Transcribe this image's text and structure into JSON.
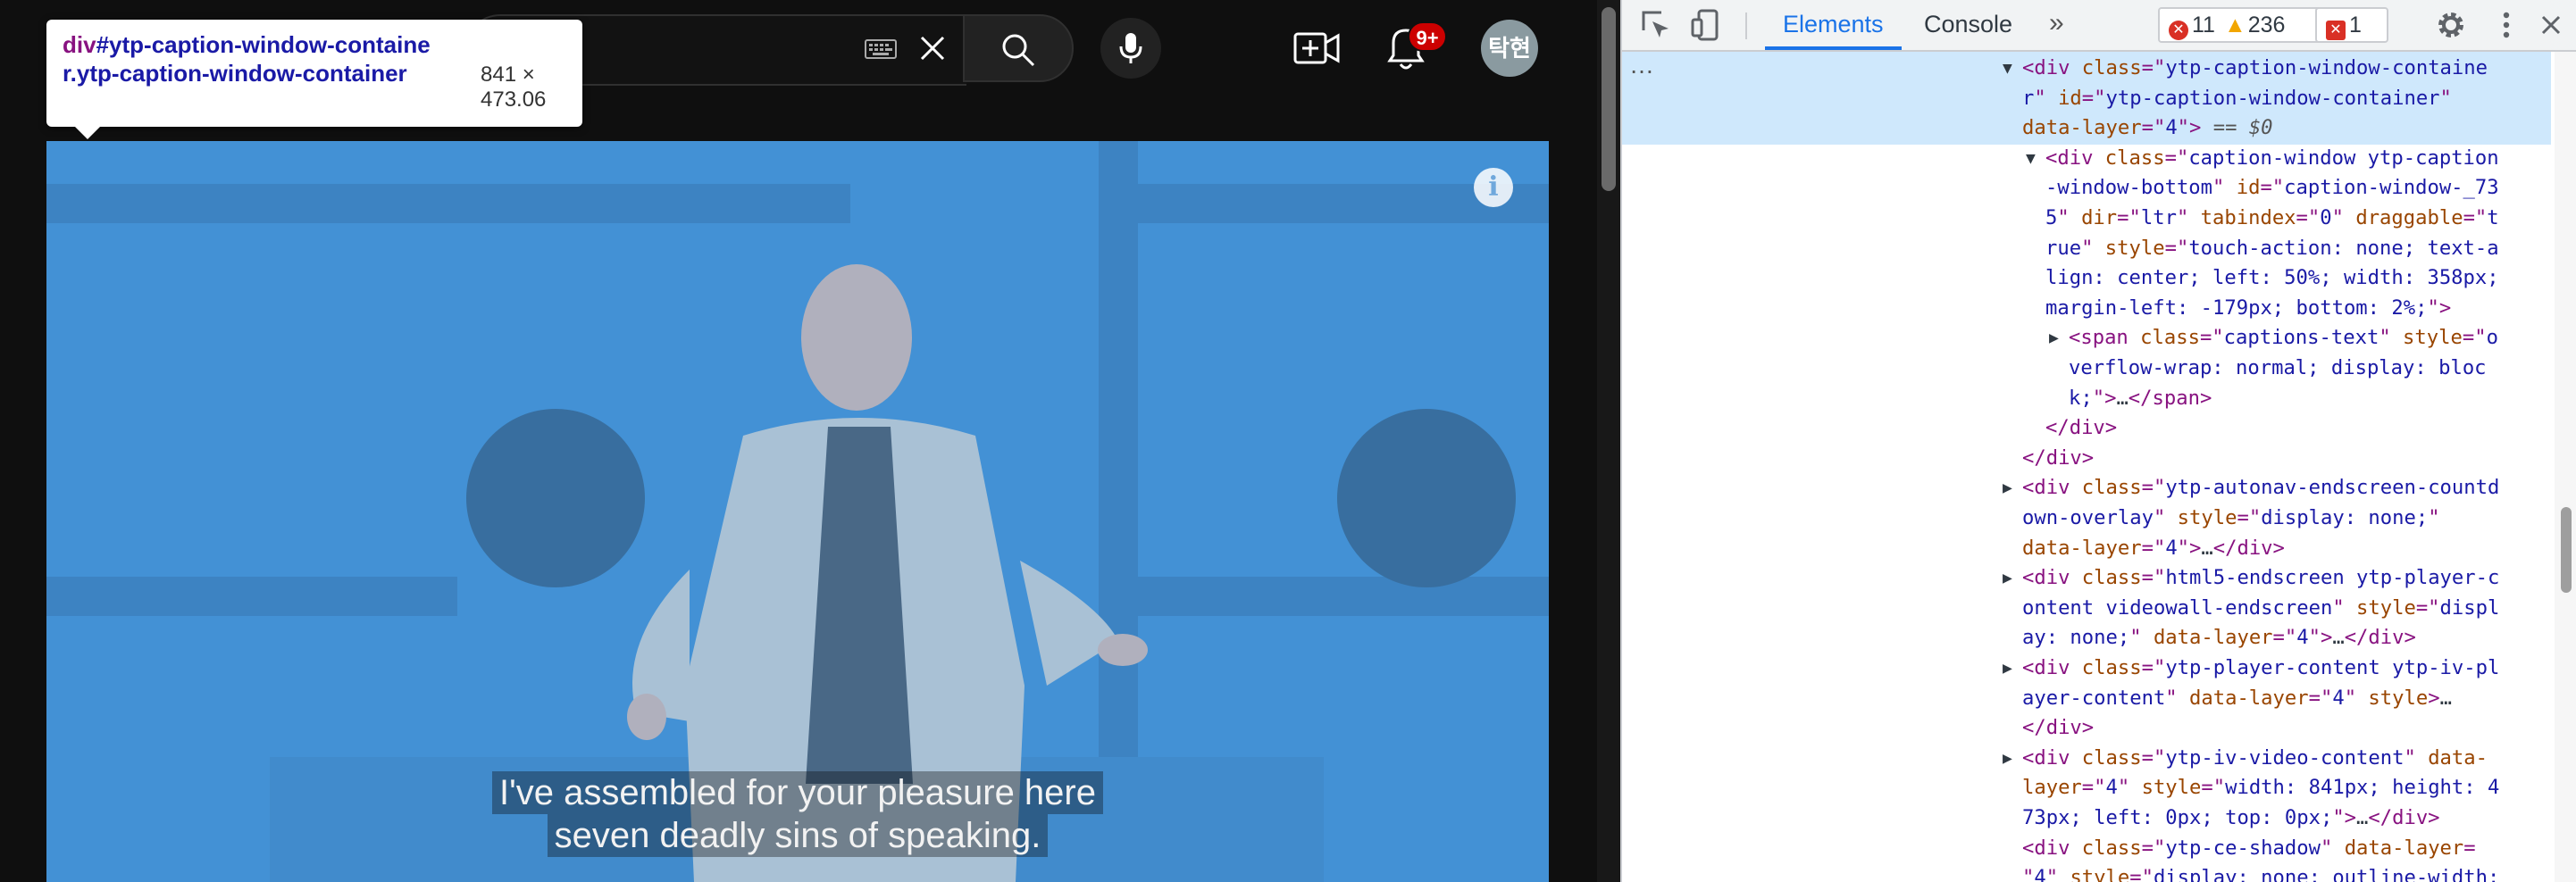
{
  "youtube": {
    "notification_count": "9+",
    "avatar_text": "탁현",
    "icons": {
      "keyboard": "keyboard-icon",
      "clear": "close-icon",
      "search": "search-icon",
      "mic": "microphone-icon",
      "create": "video-plus-icon",
      "bell": "bell-icon",
      "info": "info-icon"
    }
  },
  "inspect_tooltip": {
    "tag": "div",
    "selector": "#ytp-caption-window-container.ytp-caption-window-container",
    "dimensions": "841 × 473.06"
  },
  "video": {
    "info_glyph": "i",
    "captions": [
      "I've assembled for your pleasure here",
      "seven deadly sins of speaking."
    ]
  },
  "devtools": {
    "tabs": [
      "Elements",
      "Console"
    ],
    "active_tab": "Elements",
    "more_tabs": "»",
    "errors": "11",
    "warnings": "236",
    "issues": "1",
    "ellipsis": "…",
    "colors": {
      "accent": "#1a73e8",
      "selection": "#cfe8fc",
      "tag": "#881280",
      "attr_name": "#994500",
      "attr_value": "#1a1aa6"
    }
  },
  "dom_lines": [
    {
      "indent": 0,
      "arrow": "▼",
      "parts": [
        [
          "tag",
          "<div "
        ],
        [
          "an",
          "class"
        ],
        [
          "tag",
          "=\""
        ],
        [
          "av",
          "ytp-caption-window-containe"
        ]
      ]
    },
    {
      "indent": 0,
      "arrow": "",
      "parts": [
        [
          "av",
          "r"
        ],
        [
          "tag",
          "\" "
        ],
        [
          "an",
          "id"
        ],
        [
          "tag",
          "=\""
        ],
        [
          "av",
          "ytp-caption-window-container"
        ],
        [
          "tag",
          "\""
        ]
      ]
    },
    {
      "indent": 0,
      "arrow": "",
      "parts": [
        [
          "an",
          "data-layer"
        ],
        [
          "tag",
          "=\""
        ],
        [
          "av",
          "4"
        ],
        [
          "tag",
          "\">"
        ],
        [
          "eq",
          " == $0"
        ]
      ]
    },
    {
      "indent": 1,
      "arrow": "▼",
      "parts": [
        [
          "tag",
          "<div "
        ],
        [
          "an",
          "class"
        ],
        [
          "tag",
          "=\""
        ],
        [
          "av",
          "caption-window ytp-caption"
        ]
      ]
    },
    {
      "indent": 1,
      "arrow": "",
      "parts": [
        [
          "av",
          "-window-bottom"
        ],
        [
          "tag",
          "\" "
        ],
        [
          "an",
          "id"
        ],
        [
          "tag",
          "=\""
        ],
        [
          "av",
          "caption-window-_73"
        ]
      ]
    },
    {
      "indent": 1,
      "arrow": "",
      "parts": [
        [
          "av",
          "5"
        ],
        [
          "tag",
          "\" "
        ],
        [
          "an",
          "dir"
        ],
        [
          "tag",
          "=\""
        ],
        [
          "av",
          "ltr"
        ],
        [
          "tag",
          "\" "
        ],
        [
          "an",
          "tabindex"
        ],
        [
          "tag",
          "=\""
        ],
        [
          "av",
          "0"
        ],
        [
          "tag",
          "\" "
        ],
        [
          "an",
          "draggable"
        ],
        [
          "tag",
          "=\""
        ],
        [
          "av",
          "t"
        ]
      ]
    },
    {
      "indent": 1,
      "arrow": "",
      "parts": [
        [
          "av",
          "rue"
        ],
        [
          "tag",
          "\" "
        ],
        [
          "an",
          "style"
        ],
        [
          "tag",
          "=\""
        ],
        [
          "av",
          "touch-action: none; text-a"
        ]
      ]
    },
    {
      "indent": 1,
      "arrow": "",
      "parts": [
        [
          "av",
          "lign: center; left: 50%; width: 358px;"
        ]
      ]
    },
    {
      "indent": 1,
      "arrow": "",
      "parts": [
        [
          "av",
          "margin-left: -179px; bottom: 2%;"
        ],
        [
          "tag",
          "\">"
        ]
      ]
    },
    {
      "indent": 2,
      "arrow": "▶",
      "parts": [
        [
          "tag",
          "<span "
        ],
        [
          "an",
          "class"
        ],
        [
          "tag",
          "=\""
        ],
        [
          "av",
          "captions-text"
        ],
        [
          "tag",
          "\" "
        ],
        [
          "an",
          "style"
        ],
        [
          "tag",
          "=\""
        ],
        [
          "av",
          "o"
        ]
      ]
    },
    {
      "indent": 2,
      "arrow": "",
      "parts": [
        [
          "av",
          "verflow-wrap: normal; display: bloc"
        ]
      ]
    },
    {
      "indent": 2,
      "arrow": "",
      "parts": [
        [
          "av",
          "k;"
        ],
        [
          "tag",
          "\">"
        ],
        [
          "tx",
          "…"
        ],
        [
          "tag",
          "</span>"
        ]
      ]
    },
    {
      "indent": 1,
      "arrow": "",
      "parts": [
        [
          "tag",
          "</div>"
        ]
      ]
    },
    {
      "indent": 0,
      "arrow": "",
      "parts": [
        [
          "tag",
          "</div>"
        ]
      ]
    },
    {
      "indent": 0,
      "arrow": "▶",
      "parts": [
        [
          "tag",
          "<div "
        ],
        [
          "an",
          "class"
        ],
        [
          "tag",
          "=\""
        ],
        [
          "av",
          "ytp-autonav-endscreen-countd"
        ]
      ]
    },
    {
      "indent": 0,
      "arrow": "",
      "parts": [
        [
          "av",
          "own-overlay"
        ],
        [
          "tag",
          "\" "
        ],
        [
          "an",
          "style"
        ],
        [
          "tag",
          "=\""
        ],
        [
          "av",
          "display: none;"
        ],
        [
          "tag",
          "\""
        ]
      ]
    },
    {
      "indent": 0,
      "arrow": "",
      "parts": [
        [
          "an",
          "data-layer"
        ],
        [
          "tag",
          "=\""
        ],
        [
          "av",
          "4"
        ],
        [
          "tag",
          "\">"
        ],
        [
          "tx",
          "…"
        ],
        [
          "tag",
          "</div>"
        ]
      ]
    },
    {
      "indent": 0,
      "arrow": "▶",
      "parts": [
        [
          "tag",
          "<div "
        ],
        [
          "an",
          "class"
        ],
        [
          "tag",
          "=\""
        ],
        [
          "av",
          "html5-endscreen ytp-player-c"
        ]
      ]
    },
    {
      "indent": 0,
      "arrow": "",
      "parts": [
        [
          "av",
          "ontent videowall-endscreen"
        ],
        [
          "tag",
          "\" "
        ],
        [
          "an",
          "style"
        ],
        [
          "tag",
          "=\""
        ],
        [
          "av",
          "displ"
        ]
      ]
    },
    {
      "indent": 0,
      "arrow": "",
      "parts": [
        [
          "av",
          "ay: none;"
        ],
        [
          "tag",
          "\" "
        ],
        [
          "an",
          "data-layer"
        ],
        [
          "tag",
          "=\""
        ],
        [
          "av",
          "4"
        ],
        [
          "tag",
          "\">"
        ],
        [
          "tx",
          "…"
        ],
        [
          "tag",
          "</div>"
        ]
      ]
    },
    {
      "indent": 0,
      "arrow": "▶",
      "parts": [
        [
          "tag",
          "<div "
        ],
        [
          "an",
          "class"
        ],
        [
          "tag",
          "=\""
        ],
        [
          "av",
          "ytp-player-content ytp-iv-pl"
        ]
      ]
    },
    {
      "indent": 0,
      "arrow": "",
      "parts": [
        [
          "av",
          "ayer-content"
        ],
        [
          "tag",
          "\" "
        ],
        [
          "an",
          "data-layer"
        ],
        [
          "tag",
          "=\""
        ],
        [
          "av",
          "4"
        ],
        [
          "tag",
          "\" "
        ],
        [
          "an",
          "style"
        ],
        [
          "tag",
          ">"
        ],
        [
          "tx",
          "…"
        ]
      ]
    },
    {
      "indent": 0,
      "arrow": "",
      "parts": [
        [
          "tag",
          "</div>"
        ]
      ]
    },
    {
      "indent": 0,
      "arrow": "▶",
      "parts": [
        [
          "tag",
          "<div "
        ],
        [
          "an",
          "class"
        ],
        [
          "tag",
          "=\""
        ],
        [
          "av",
          "ytp-iv-video-content"
        ],
        [
          "tag",
          "\" "
        ],
        [
          "an",
          "data-"
        ]
      ]
    },
    {
      "indent": 0,
      "arrow": "",
      "parts": [
        [
          "an",
          "layer"
        ],
        [
          "tag",
          "=\""
        ],
        [
          "av",
          "4"
        ],
        [
          "tag",
          "\" "
        ],
        [
          "an",
          "style"
        ],
        [
          "tag",
          "=\""
        ],
        [
          "av",
          "width: 841px; height: 4"
        ]
      ]
    },
    {
      "indent": 0,
      "arrow": "",
      "parts": [
        [
          "av",
          "73px; left: 0px; top: 0px;"
        ],
        [
          "tag",
          "\">"
        ],
        [
          "tx",
          "…"
        ],
        [
          "tag",
          "</div>"
        ]
      ]
    },
    {
      "indent": 0,
      "arrow": "",
      "parts": [
        [
          "tag",
          "<div "
        ],
        [
          "an",
          "class"
        ],
        [
          "tag",
          "=\""
        ],
        [
          "av",
          "ytp-ce-shadow"
        ],
        [
          "tag",
          "\" "
        ],
        [
          "an",
          "data-layer"
        ],
        [
          "tag",
          "="
        ]
      ]
    },
    {
      "indent": 0,
      "arrow": "",
      "parts": [
        [
          "tag",
          "\""
        ],
        [
          "av",
          "4"
        ],
        [
          "tag",
          "\" "
        ],
        [
          "an",
          "style"
        ],
        [
          "tag",
          "=\""
        ],
        [
          "av",
          "display: none; outline-width:"
        ]
      ]
    }
  ]
}
